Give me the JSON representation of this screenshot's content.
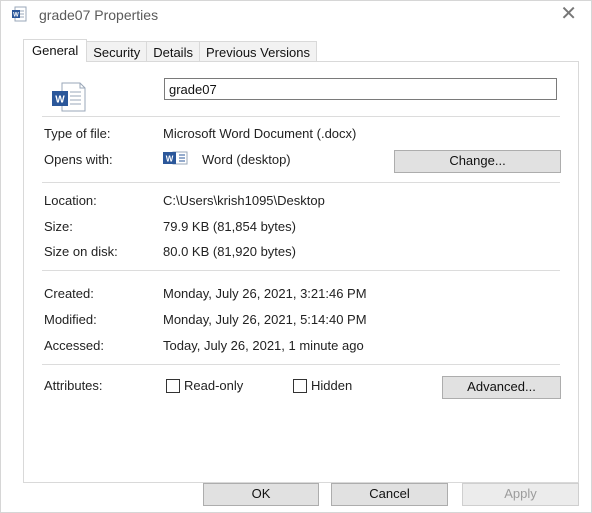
{
  "window": {
    "title": "grade07 Properties",
    "close_glyph": "✕"
  },
  "tabs": [
    {
      "label": "General",
      "active": true
    },
    {
      "label": "Security",
      "active": false
    },
    {
      "label": "Details",
      "active": false
    },
    {
      "label": "Previous Versions",
      "active": false
    }
  ],
  "general": {
    "file_name": "grade07",
    "file_icon": "word-document-icon",
    "type_label": "Type of file:",
    "type_value": "Microsoft Word Document (.docx)",
    "opens_label": "Opens with:",
    "opens_icon": "word-app-icon",
    "opens_value": "Word (desktop)",
    "change_button": "Change...",
    "location_label": "Location:",
    "location_value": "C:\\Users\\krish1095\\Desktop",
    "size_label": "Size:",
    "size_value": "79.9 KB (81,854 bytes)",
    "size_disk_label": "Size on disk:",
    "size_disk_value": "80.0 KB (81,920 bytes)",
    "created_label": "Created:",
    "created_value": "Monday, July 26, 2021, 3:21:46 PM",
    "modified_label": "Modified:",
    "modified_value": "Monday, July 26, 2021, 5:14:40 PM",
    "accessed_label": "Accessed:",
    "accessed_value": "Today, July 26, 2021, 1 minute ago",
    "attributes_label": "Attributes:",
    "readonly_label": "Read-only",
    "readonly_checked": false,
    "hidden_label": "Hidden",
    "hidden_checked": false,
    "advanced_button": "Advanced..."
  },
  "footer": {
    "ok_button": "OK",
    "cancel_button": "Cancel",
    "apply_button": "Apply",
    "apply_disabled": true
  },
  "colors": {
    "word_blue": "#2b579a",
    "separator": "#dcdcdc",
    "button_face": "#e1e1e1"
  }
}
